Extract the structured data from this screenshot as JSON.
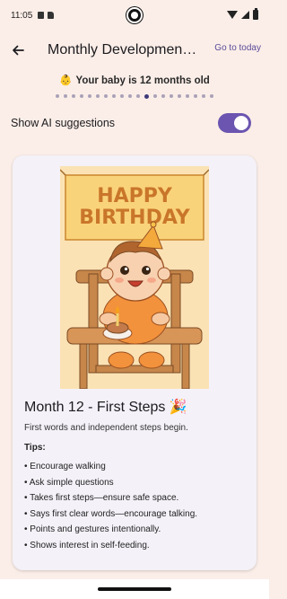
{
  "status": {
    "time": "11:05"
  },
  "appbar": {
    "title": "Monthly Developmen…",
    "go_today": "Go to today",
    "back_icon": "arrow-back-icon"
  },
  "age": {
    "emoji": "👶",
    "text": "Your baby is 12 months old"
  },
  "pager": {
    "total_dots": 20,
    "active_index": 11
  },
  "ai": {
    "label": "Show AI suggestions",
    "enabled": true
  },
  "card": {
    "banner_line1": "HAPPY",
    "banner_line2": "BIRTHDAY",
    "title": "Month 12 - First Steps 🎉",
    "description": "First words and independent steps begin.",
    "tips_label": "Tips:",
    "tips": [
      "Encourage walking",
      "Ask simple questions",
      "Takes first steps—ensure safe space.",
      "Says first clear words—encourage talking.",
      "Points and gestures intentionally.",
      "Shows interest in self-feeding."
    ]
  },
  "colors": {
    "accent": "#6b55b0",
    "background": "#fbeee8",
    "card": "#f4f1f8"
  }
}
